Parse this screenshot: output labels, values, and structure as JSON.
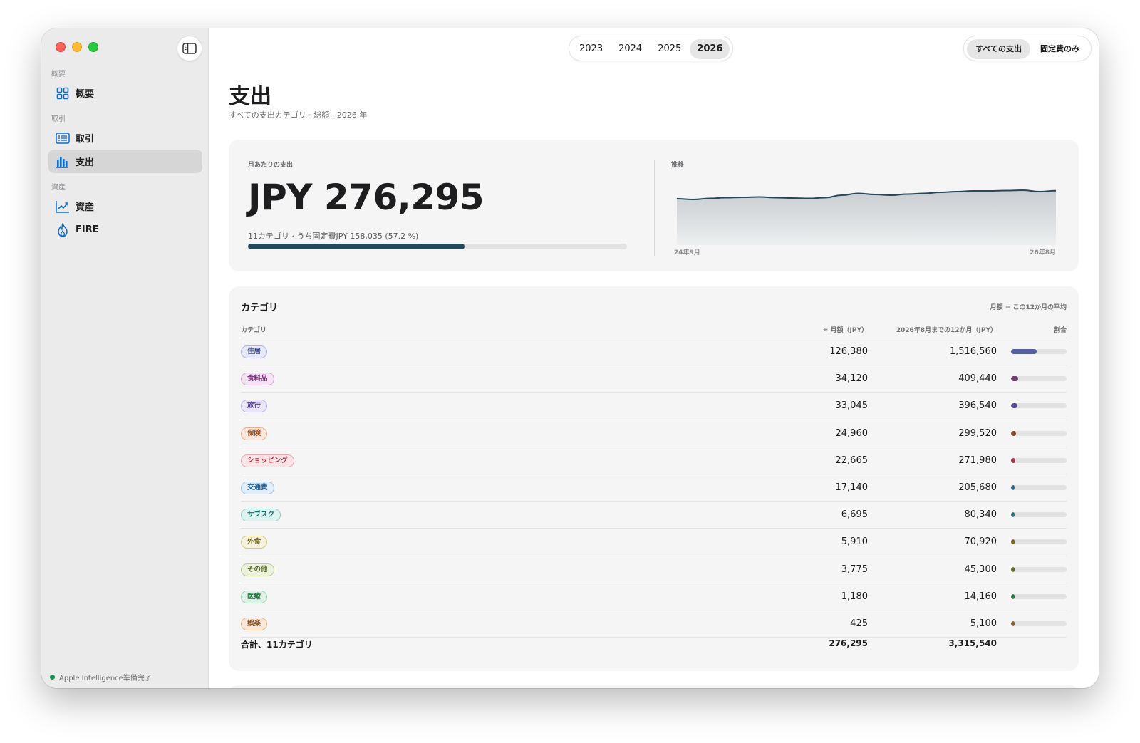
{
  "sidebar": {
    "sections": [
      {
        "label": "概要",
        "items": [
          {
            "label": "概要",
            "icon": "grid-icon"
          }
        ]
      },
      {
        "label": "取引",
        "items": [
          {
            "label": "取引",
            "icon": "list-icon"
          },
          {
            "label": "支出",
            "icon": "bar-chart-icon",
            "active": true
          }
        ]
      },
      {
        "label": "資産",
        "items": [
          {
            "label": "資産",
            "icon": "trend-icon"
          },
          {
            "label": "FIRE",
            "icon": "flame-icon"
          }
        ]
      }
    ],
    "status": "Apple Intelligence準備完了"
  },
  "years": [
    "2023",
    "2024",
    "2025",
    "2026"
  ],
  "selected_year": "2026",
  "filters": [
    "すべての支出",
    "固定費のみ"
  ],
  "selected_filter": "すべての支出",
  "header": {
    "title": "支出",
    "subtitle": "すべての支出カテゴリ · 総額 · 2026 年"
  },
  "summary": {
    "label": "月あたりの支出",
    "amount": "JPY 276,295",
    "breakdown": "11カテゴリ · うち固定費JPY 158,035 (57.2 %)",
    "fixed_ratio": 0.572
  },
  "trend": {
    "label": "推移",
    "start_label": "24年9月",
    "end_label": "26年8月",
    "values": [
      265000,
      264000,
      265500,
      266500,
      267000,
      267500,
      266500,
      266000,
      265500,
      266500,
      270000,
      272500,
      271000,
      270000,
      271500,
      272500,
      274000,
      275000,
      276000,
      276000,
      276500,
      277000,
      275000,
      276295
    ],
    "y_min": 200000,
    "y_max": 300000
  },
  "categories_table": {
    "title": "カテゴリ",
    "note": "月額 = この12か月の平均",
    "columns": [
      "カテゴリ",
      "≈ 月額（JPY）",
      "2026年8月までの12か月（JPY）",
      "割合"
    ],
    "rows": [
      {
        "name": "住居",
        "monthly": "126,380",
        "yearly": "1,516,560",
        "share": 0.457,
        "color": "#5560a0",
        "tag_bg": "#e6e8f6",
        "tag_border": "#aeb4df",
        "tag_fg": "#3f4a8a"
      },
      {
        "name": "食料品",
        "monthly": "34,120",
        "yearly": "409,440",
        "share": 0.123,
        "color": "#6e3f6a",
        "tag_bg": "#f3e4f3",
        "tag_border": "#d2a6d2",
        "tag_fg": "#7b2f78"
      },
      {
        "name": "旅行",
        "monthly": "33,045",
        "yearly": "396,540",
        "share": 0.12,
        "color": "#5a4d8a",
        "tag_bg": "#ebe6f7",
        "tag_border": "#b9aee0",
        "tag_fg": "#55418f"
      },
      {
        "name": "保険",
        "monthly": "24,960",
        "yearly": "299,520",
        "share": 0.09,
        "color": "#8a4a2a",
        "tag_bg": "#fbe8dc",
        "tag_border": "#e6b095",
        "tag_fg": "#9a4a20"
      },
      {
        "name": "ショッピング",
        "monthly": "22,665",
        "yearly": "271,980",
        "share": 0.082,
        "color": "#9a3a48",
        "tag_bg": "#fbe4e6",
        "tag_border": "#e8a6ae",
        "tag_fg": "#a03444"
      },
      {
        "name": "交通費",
        "monthly": "17,140",
        "yearly": "205,680",
        "share": 0.062,
        "color": "#2a6a9a",
        "tag_bg": "#e2eef9",
        "tag_border": "#9fc3e3",
        "tag_fg": "#23608f"
      },
      {
        "name": "サブスク",
        "monthly": "6,695",
        "yearly": "80,340",
        "share": 0.024,
        "color": "#1d7a74",
        "tag_bg": "#dff3f1",
        "tag_border": "#8fd0c9",
        "tag_fg": "#16706a"
      },
      {
        "name": "外食",
        "monthly": "5,910",
        "yearly": "70,920",
        "share": 0.021,
        "color": "#7a6a1a",
        "tag_bg": "#f5f1da",
        "tag_border": "#d4c98a",
        "tag_fg": "#6e5f14"
      },
      {
        "name": "その他",
        "monthly": "3,775",
        "yearly": "45,300",
        "share": 0.014,
        "color": "#5a6a2a",
        "tag_bg": "#edf2df",
        "tag_border": "#bccb92",
        "tag_fg": "#56662a"
      },
      {
        "name": "医療",
        "monthly": "1,180",
        "yearly": "14,160",
        "share": 0.004,
        "color": "#2a7a4a",
        "tag_bg": "#e0f2e7",
        "tag_border": "#94cfaa",
        "tag_fg": "#23703f"
      },
      {
        "name": "娯楽",
        "monthly": "425",
        "yearly": "5,100",
        "share": 0.002,
        "color": "#8a5a2a",
        "tag_bg": "#f8e9da",
        "tag_border": "#dcb38a",
        "tag_fg": "#8a531e"
      }
    ],
    "total": {
      "label": "合計、11カテゴリ",
      "monthly": "276,295",
      "yearly": "3,315,540"
    }
  },
  "colors": {
    "accent": "#0a6cd8",
    "ratio_bar": "#24495a",
    "trend_line": "#24495a"
  }
}
